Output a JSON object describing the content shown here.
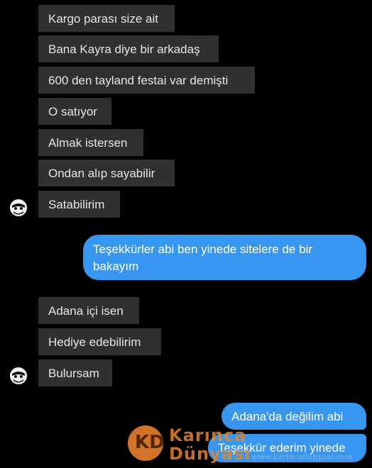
{
  "conversation": {
    "incoming_group_1": [
      "Kargo parası size ait",
      "Bana Kayra diye bir arkadaş",
      "600 den tayland festai var demişti",
      "O satıyor",
      "Almak istersen",
      "Ondan alıp sayabilir",
      "Satabilirim"
    ],
    "outgoing_1": "Teşekkürler abi ben yinede sitelere de bir bakayım",
    "incoming_group_2": [
      "Adana içi isen",
      "Hediye edebilirim",
      "Bulursam"
    ],
    "outgoing_2": [
      "Adana'da değilim abi",
      "Teşekkür ederim yinede"
    ]
  },
  "watermark": {
    "logo_letters": "KD",
    "brand_line1": "Karınca",
    "brand_line2": "Dünyası",
    "url": "www.karincadunyasi.com"
  },
  "colors": {
    "background": "#000000",
    "incoming_bubble": "#303030",
    "outgoing_bubble": "#3797f0"
  },
  "icons": {
    "contact_avatar": "masked-face-avatar-icon"
  }
}
